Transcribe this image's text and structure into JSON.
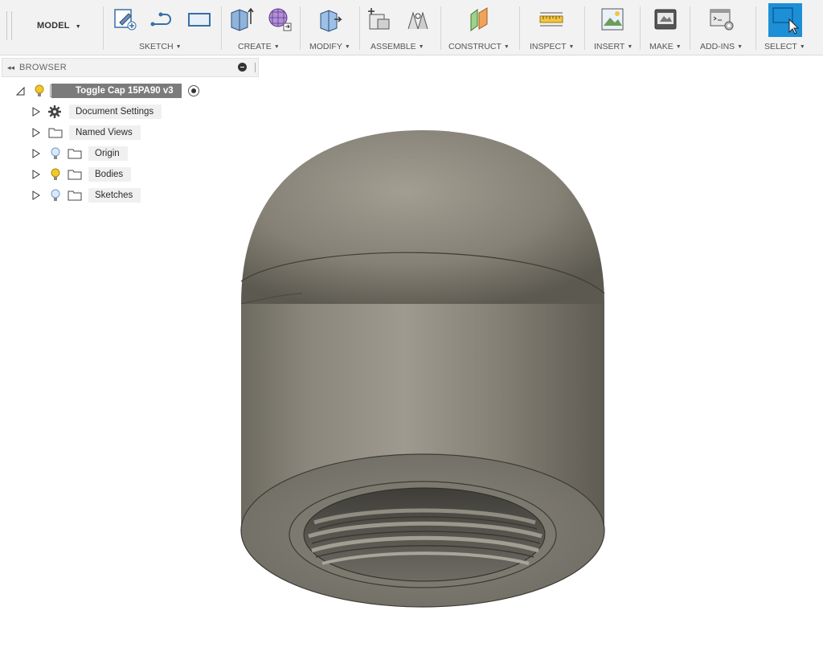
{
  "toolbar": {
    "workspace_label": "MODEL",
    "groups": [
      {
        "label": "SKETCH"
      },
      {
        "label": "CREATE"
      },
      {
        "label": "MODIFY"
      },
      {
        "label": "ASSEMBLE"
      },
      {
        "label": "CONSTRUCT"
      },
      {
        "label": "INSPECT"
      },
      {
        "label": "INSERT"
      },
      {
        "label": "MAKE"
      },
      {
        "label": "ADD-INS"
      },
      {
        "label": "SELECT"
      }
    ],
    "caret": "▼"
  },
  "browser": {
    "title": "BROWSER",
    "collapse_glyph": "◂◂",
    "root": {
      "label": "Toggle Cap 15PA90 v3"
    },
    "items": [
      {
        "label": "Document Settings",
        "icon": "gear-icon"
      },
      {
        "label": "Named Views",
        "icon": "folder-icon"
      },
      {
        "label": "Origin",
        "icon": "lightbulb-off-icon"
      },
      {
        "label": "Bodies",
        "icon": "lightbulb-on-icon"
      },
      {
        "label": "Sketches",
        "icon": "lightbulb-off-icon"
      }
    ]
  },
  "colors": {
    "accent_select": "#1d8fd6",
    "bulb_on": "#f3c72a",
    "bulb_off": "#a9c8e8",
    "model_metal": "#8d897e"
  }
}
